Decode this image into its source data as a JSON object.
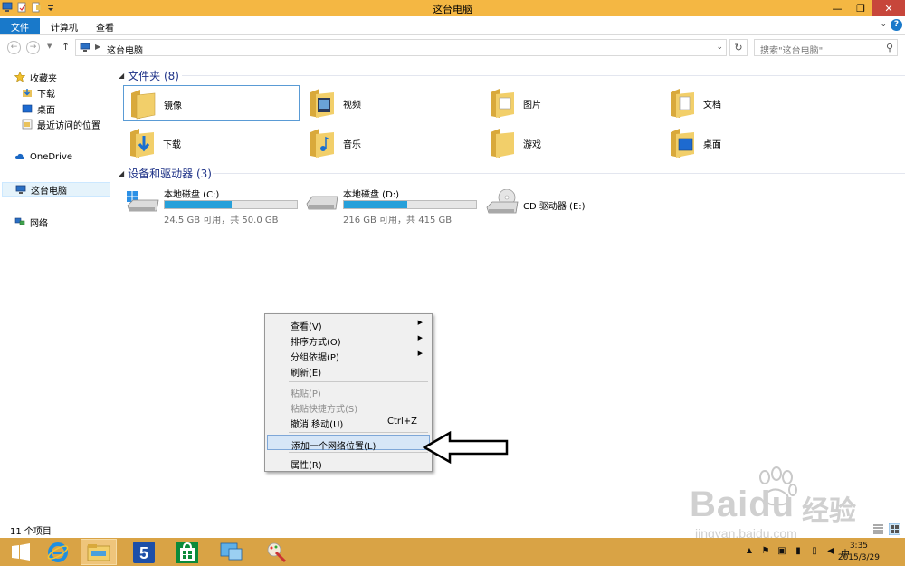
{
  "window": {
    "title": "这台电脑",
    "controls": {
      "minimize": "—",
      "maximize": "❐",
      "close": "✕"
    }
  },
  "ribbon": {
    "tabs": [
      {
        "label": "文件",
        "active": true
      },
      {
        "label": "计算机",
        "active": false
      },
      {
        "label": "查看",
        "active": false
      }
    ],
    "help": "?"
  },
  "address": {
    "path": "这台电脑",
    "search_placeholder": "搜索\"这台电脑\""
  },
  "sidebar": {
    "favorites": {
      "label": "收藏夹",
      "items": [
        "下载",
        "桌面",
        "最近访问的位置"
      ]
    },
    "onedrive": "OneDrive",
    "this_pc": "这台电脑",
    "network": "网络"
  },
  "folders": {
    "header": "文件夹 (8)",
    "items": [
      "镜像",
      "视频",
      "图片",
      "文档",
      "下载",
      "音乐",
      "游戏",
      "桌面"
    ]
  },
  "devices": {
    "header": "设备和驱动器 (3)",
    "items": [
      {
        "name": "本地磁盘 (C:)",
        "size": "24.5 GB 可用，共 50.0 GB",
        "used_fraction": 0.51
      },
      {
        "name": "本地磁盘 (D:)",
        "size": "216 GB 可用，共 415 GB",
        "used_fraction": 0.48
      },
      {
        "name": "CD 驱动器 (E:)"
      }
    ]
  },
  "context_menu": {
    "items": [
      {
        "label": "查看(V)",
        "submenu": "▶"
      },
      {
        "label": "排序方式(O)",
        "submenu": "▶"
      },
      {
        "label": "分组依据(P)",
        "submenu": "▶"
      },
      {
        "label": "刷新(E)"
      },
      {
        "label": "粘贴(P)",
        "disabled": true
      },
      {
        "label": "粘贴快捷方式(S)",
        "disabled": true
      },
      {
        "label": "撤消 移动(U)",
        "shortcut": "Ctrl+Z"
      },
      {
        "label": "添加一个网络位置(L)",
        "highlighted": true
      },
      {
        "label": "属性(R)"
      }
    ]
  },
  "status": {
    "item_count": "11 个项目"
  },
  "watermark": {
    "brand": "Bai",
    "brand2": "du",
    "cn": "经验",
    "url": "jingyan.baidu.com"
  },
  "taskbar": {
    "time": "3:35",
    "date": "2015/3/29",
    "ime": "中"
  },
  "colors": {
    "titlebar": "#f4b743",
    "accent": "#1979ca",
    "taskbar": "#d9a345",
    "drive_bar": "#26a0da",
    "group_header": "#1e3287"
  }
}
